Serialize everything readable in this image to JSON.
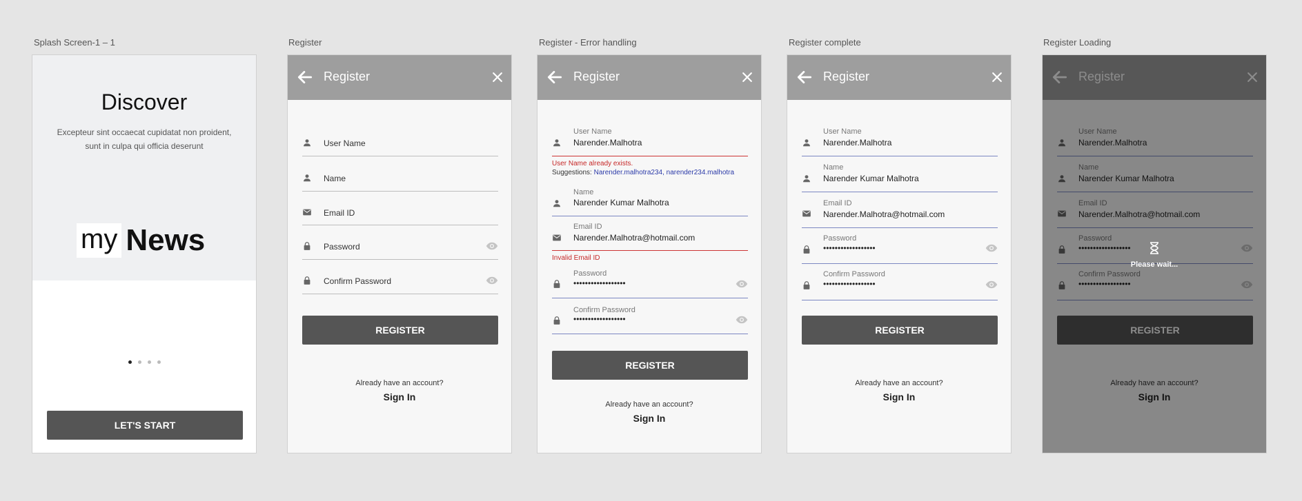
{
  "artboards": {
    "splash": "Splash Screen-1 – 1",
    "register": "Register",
    "error": "Register - Error handling",
    "complete": "Register complete",
    "loading": "Register Loading"
  },
  "splash": {
    "heading": "Discover",
    "desc_line1": "Excepteur sint occaecat cupidatat non proident,",
    "desc_line2": "sunt in culpa qui officia deserunt",
    "logo_my": "my",
    "logo_news": "News",
    "start_button": "LET'S START",
    "pages": 4,
    "active_page": 1
  },
  "register": {
    "title": "Register",
    "username_label": "User Name",
    "name_label": "Name",
    "email_label": "Email ID",
    "password_label": "Password",
    "confirm_label": "Confirm Password",
    "register_button": "REGISTER",
    "have_account": "Already have an account?",
    "sign_in": "Sign In"
  },
  "filled": {
    "username": "Narender.Malhotra",
    "name": "Narender Kumar Malhotra",
    "email": "Narender.Malhotra@hotmail.com",
    "password": "••••••••••••••••••",
    "confirm": "••••••••••••••••••"
  },
  "errors": {
    "username_exists": "User Name already exists.",
    "suggestions_label": "Suggestions:",
    "suggestions": "Narender.malhotra234, narender234.malhotra",
    "invalid_email": "Invalid Email ID"
  },
  "loading": {
    "message": "Please wait..."
  },
  "colors": {
    "appbar": "#9e9e9e",
    "button": "#555555",
    "error": "#c62828",
    "focus_line": "#7b87c2",
    "link": "#2b3aa8"
  }
}
